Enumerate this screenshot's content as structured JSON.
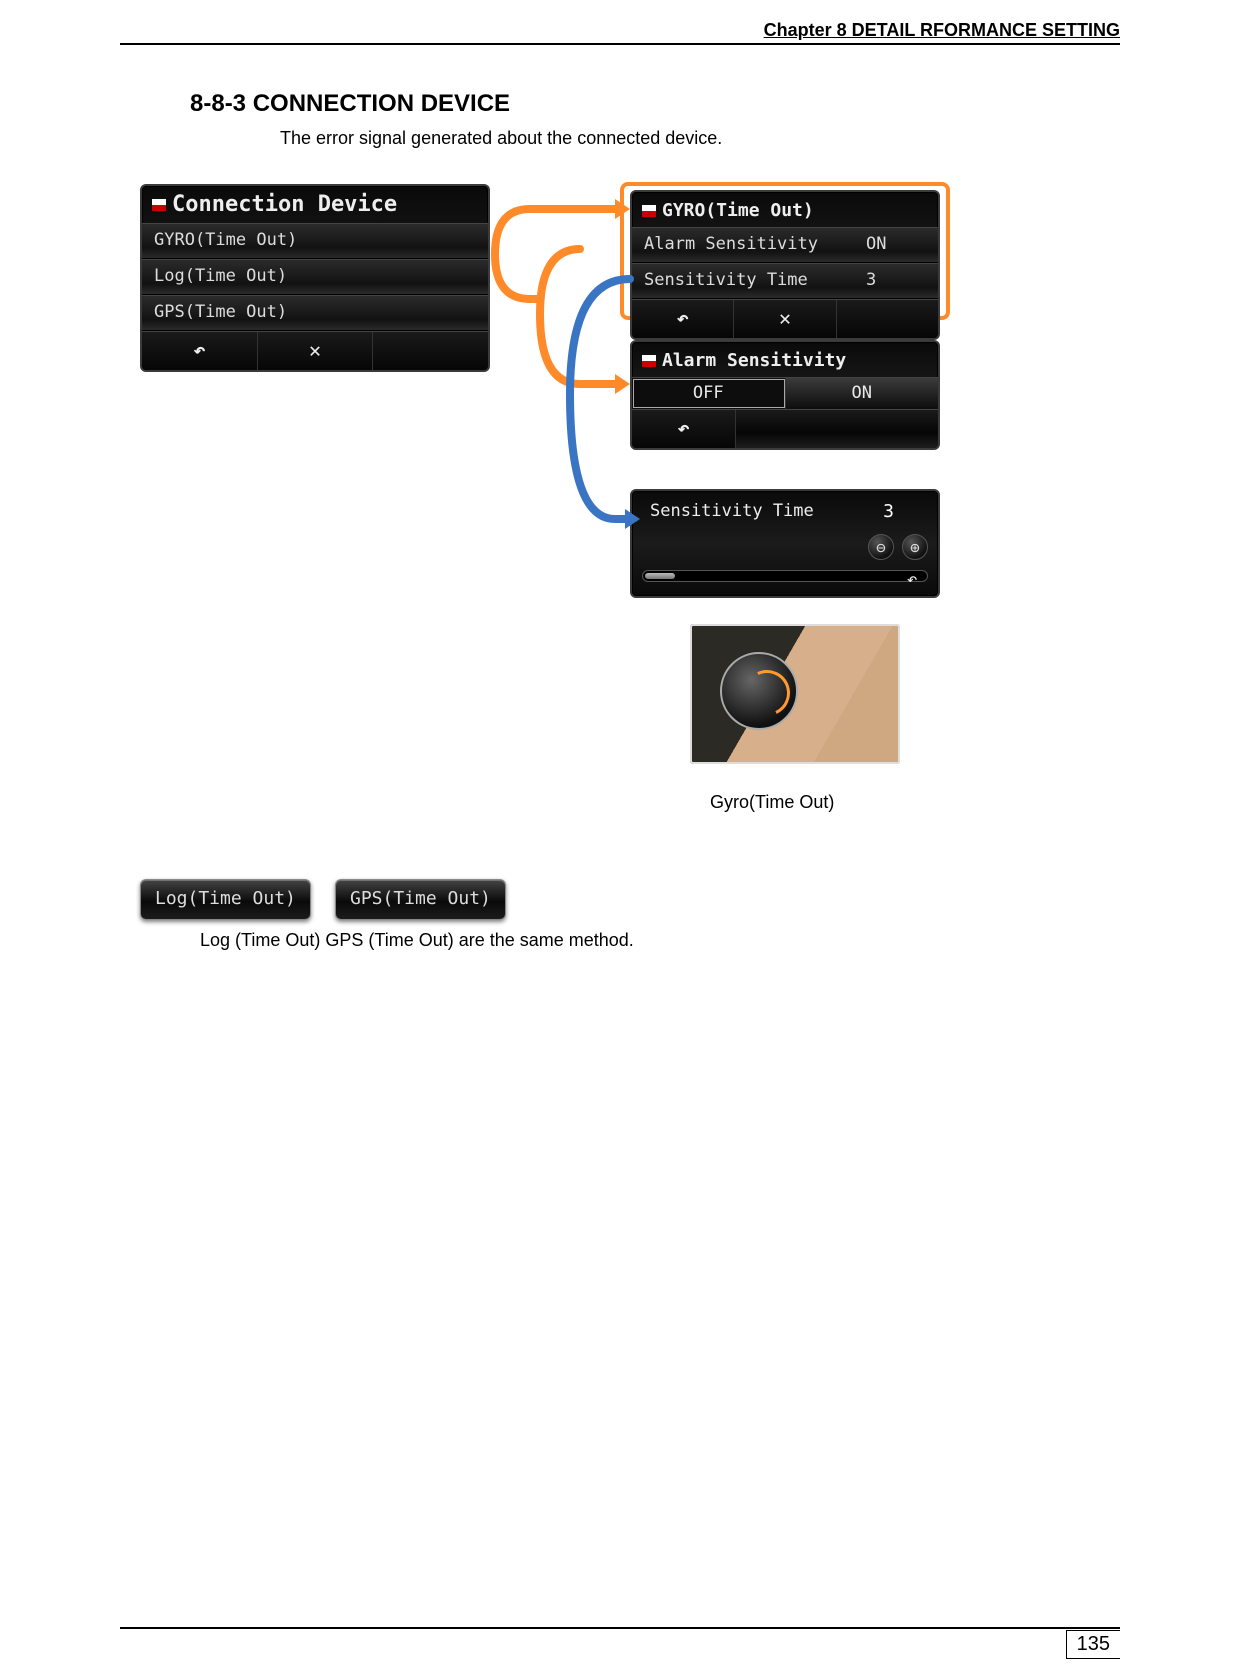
{
  "header": {
    "chapter": "Chapter 8  DETAIL RFORMANCE SETTING"
  },
  "section": {
    "number_title": "8-8-3 CONNECTION DEVICE",
    "intro": "The error signal generated about the connected device."
  },
  "connection_panel": {
    "title": "Connection Device",
    "items": [
      "GYRO(Time Out)",
      "Log(Time Out)",
      "GPS(Time Out)"
    ],
    "footer": {
      "back": "↶",
      "close": "✕"
    }
  },
  "gyro_panel": {
    "title": "GYRO(Time Out)",
    "rows": [
      {
        "label": "Alarm Sensitivity",
        "value": "ON"
      },
      {
        "label": "Sensitivity Time",
        "value": "3"
      }
    ],
    "footer": {
      "back": "↶",
      "close": "✕"
    }
  },
  "alarm_panel": {
    "title": "Alarm Sensitivity",
    "options": [
      "OFF",
      "ON"
    ],
    "selected": "OFF",
    "footer": {
      "back": "↶"
    }
  },
  "sens_panel": {
    "title": "Sensitivity Time",
    "value": "3",
    "minus": "⊖",
    "plus": "⊕",
    "back": "↶"
  },
  "captions": {
    "gyro": "Gyro(Time Out)",
    "bottom": "Log (Time Out)   GPS (Time Out) are the same method."
  },
  "pills": {
    "log": "Log(Time Out)",
    "gps": "GPS(Time Out)"
  },
  "footer": {
    "page": "135"
  }
}
